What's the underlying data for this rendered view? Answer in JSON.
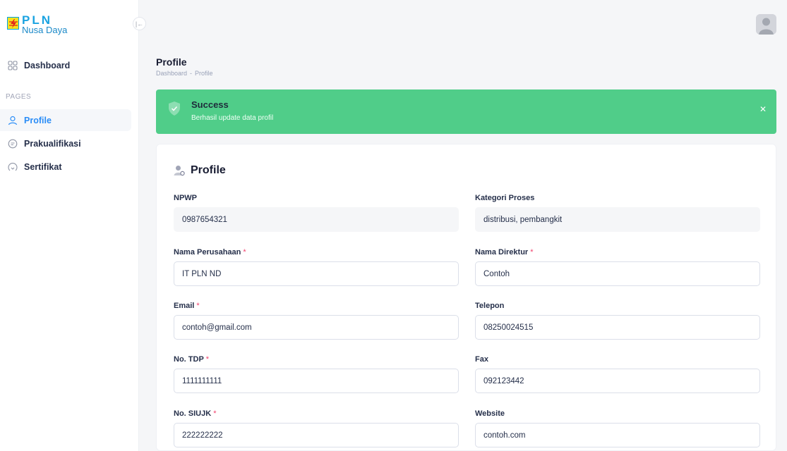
{
  "brand": {
    "name": "PLN",
    "subtitle": "Nusa Daya"
  },
  "sidebar": {
    "section_label": "PAGES",
    "items": [
      {
        "label": "Dashboard",
        "icon": "grid-icon"
      },
      {
        "label": "Profile",
        "icon": "user-icon",
        "active": true
      },
      {
        "label": "Prakualifikasi",
        "icon": "document-badge-icon"
      },
      {
        "label": "Sertifikat",
        "icon": "certificate-icon"
      }
    ]
  },
  "header": {
    "title": "Profile",
    "breadcrumb": [
      "Dashboard",
      "-",
      "Profile"
    ]
  },
  "alert": {
    "title": "Success",
    "message": "Berhasil update data profil",
    "color": "#50cd89"
  },
  "card": {
    "title": "Profile",
    "fields": [
      {
        "label": "NPWP",
        "value": "0987654321",
        "required": false,
        "readonly": true
      },
      {
        "label": "Kategori Proses",
        "value": "distribusi, pembangkit",
        "required": false,
        "readonly": true
      },
      {
        "label": "Nama Perusahaan",
        "value": "IT PLN ND",
        "required": true
      },
      {
        "label": "Nama Direktur",
        "value": "Contoh",
        "required": true
      },
      {
        "label": "Email",
        "value": "contoh@gmail.com",
        "required": true
      },
      {
        "label": "Telepon",
        "value": "08250024515",
        "required": false
      },
      {
        "label": "No. TDP",
        "value": "1111111111",
        "required": true
      },
      {
        "label": "Fax",
        "value": "092123442",
        "required": false
      },
      {
        "label": "No. SIUJK",
        "value": "222222222",
        "required": true
      },
      {
        "label": "Website",
        "value": "contoh.com",
        "required": false
      }
    ],
    "required_marker": "*"
  },
  "colors": {
    "primary": "#2a8df7",
    "success": "#50cd89",
    "danger": "#f1416c"
  }
}
